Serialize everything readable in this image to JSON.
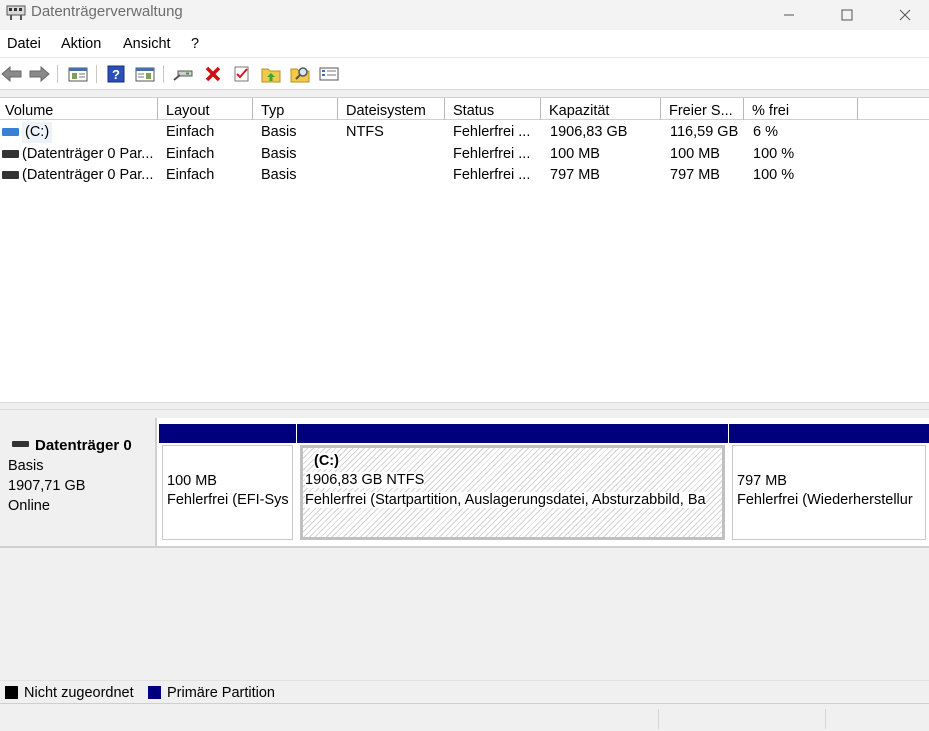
{
  "window": {
    "title": "Datenträgerverwaltung"
  },
  "menu": [
    "Datei",
    "Aktion",
    "Ansicht",
    "?"
  ],
  "toolbar_icons": [
    "back-arrow-icon",
    "forward-arrow-icon",
    "show-hide-console-tree-icon",
    "help-icon",
    "properties-pane-icon",
    "connect-drive-icon",
    "delete-icon",
    "check-properties-icon",
    "folder-up-icon",
    "folder-search-icon",
    "list-view-icon"
  ],
  "columns": [
    "Volume",
    "Layout",
    "Typ",
    "Dateisystem",
    "Status",
    "Kapazität",
    "Freier S...",
    "% frei"
  ],
  "volumes": [
    {
      "volume": "(C:)",
      "layout": "Einfach",
      "typ": "Basis",
      "dateisystem": "NTFS",
      "status": "Fehlerfrei ...",
      "kapazitaet": "1906,83 GB",
      "frei": "116,59 GB",
      "prozent": "6 %",
      "icon_color": "#3b7fd4"
    },
    {
      "volume": "(Datenträger 0 Par...",
      "layout": "Einfach",
      "typ": "Basis",
      "dateisystem": "",
      "status": "Fehlerfrei ...",
      "kapazitaet": "100 MB",
      "frei": "100 MB",
      "prozent": "100 %",
      "icon_color": "#333333"
    },
    {
      "volume": "(Datenträger 0 Par...",
      "layout": "Einfach",
      "typ": "Basis",
      "dateisystem": "",
      "status": "Fehlerfrei ...",
      "kapazitaet": "797 MB",
      "frei": "797 MB",
      "prozent": "100 %",
      "icon_color": "#333333"
    }
  ],
  "disk": {
    "name": "Datenträger 0",
    "type": "Basis",
    "size": "1907,71 GB",
    "state": "Online",
    "partitions": [
      {
        "label": "",
        "size": "100 MB",
        "status": "Fehlerfrei (EFI-Sys"
      },
      {
        "label": "(C:)",
        "size": "1906,83 GB NTFS",
        "status": "Fehlerfrei (Startpartition, Auslagerungsdatei, Absturzabbild, Ba"
      },
      {
        "label": "",
        "size": "797 MB",
        "status": "Fehlerfrei (Wiederherstellur"
      }
    ]
  },
  "legend": [
    {
      "label": "Nicht zugeordnet",
      "color": "#000000"
    },
    {
      "label": "Primäre Partition",
      "color": "#00007f"
    }
  ]
}
